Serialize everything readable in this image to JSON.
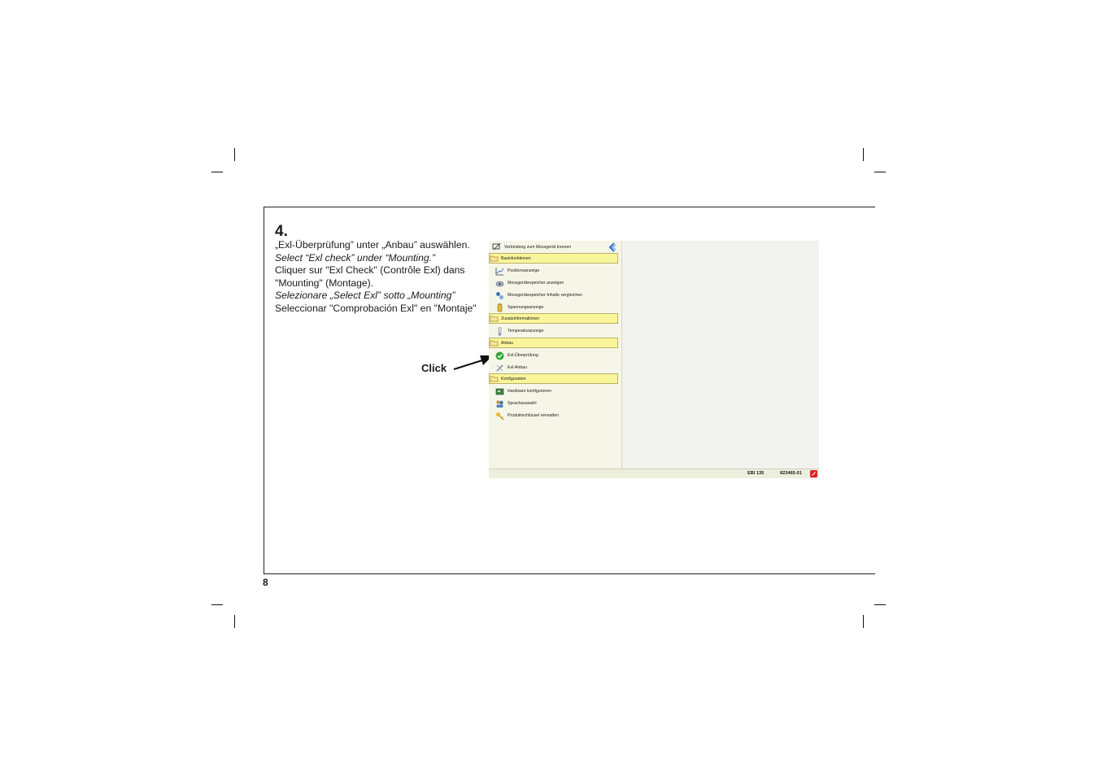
{
  "page": {
    "step": "4.",
    "page_number": "8",
    "instructions": [
      "„Exl-Überprüfung” unter „Anbau” auswählen.",
      "Select “Exl check” under “Mounting.”",
      "Cliquer sur \"Exl Check\" (Contrôle Exl) dans",
      "\"Mounting\" (Montage).",
      "Selezionare „Select Exl” sotto „Mounting”",
      "Seleccionar \"Comprobación Exl\" en \"Montaje\""
    ],
    "click_label": "Click"
  },
  "app": {
    "top_action": "Verbindung zum Messgerät trennen",
    "sections": [
      {
        "label": "Basisfunktionen",
        "items": [
          "Positionsanzeige",
          "Messgerätespeicher anzeigen",
          "Messgerätespeicher-Inhalte vergleichen",
          "Spannungsanzeige"
        ]
      },
      {
        "label": "Zusatzinformationen",
        "items": [
          "Temperaturanzeige"
        ]
      },
      {
        "label": "Anbau",
        "items": [
          "Exl-Überprüfung",
          "Exl-Anbau"
        ]
      },
      {
        "label": "Konfiguration",
        "items": [
          "Hardware konfigurieren",
          "Sprachauswahl",
          "Produktschlüssel verwalten"
        ]
      }
    ],
    "status": {
      "model": "EBI 135",
      "serial": "823465-01"
    },
    "icons": {
      "top_action": "disconnect-icon",
      "folders": "folder-icon",
      "items": [
        "position-chart-icon",
        "memory-view-icon",
        "memory-compare-icon",
        "battery-icon",
        "thermometer-icon",
        "checkmark-icon",
        "tools-icon",
        "hardware-board-icon",
        "language-icon",
        "key-icon"
      ],
      "collapse": "collapse-arrow-icon",
      "status": "status-icon"
    },
    "colors": {
      "section_header": "#f9f59a",
      "check_green": "#2fa53b",
      "status_red": "#d9262b"
    }
  }
}
